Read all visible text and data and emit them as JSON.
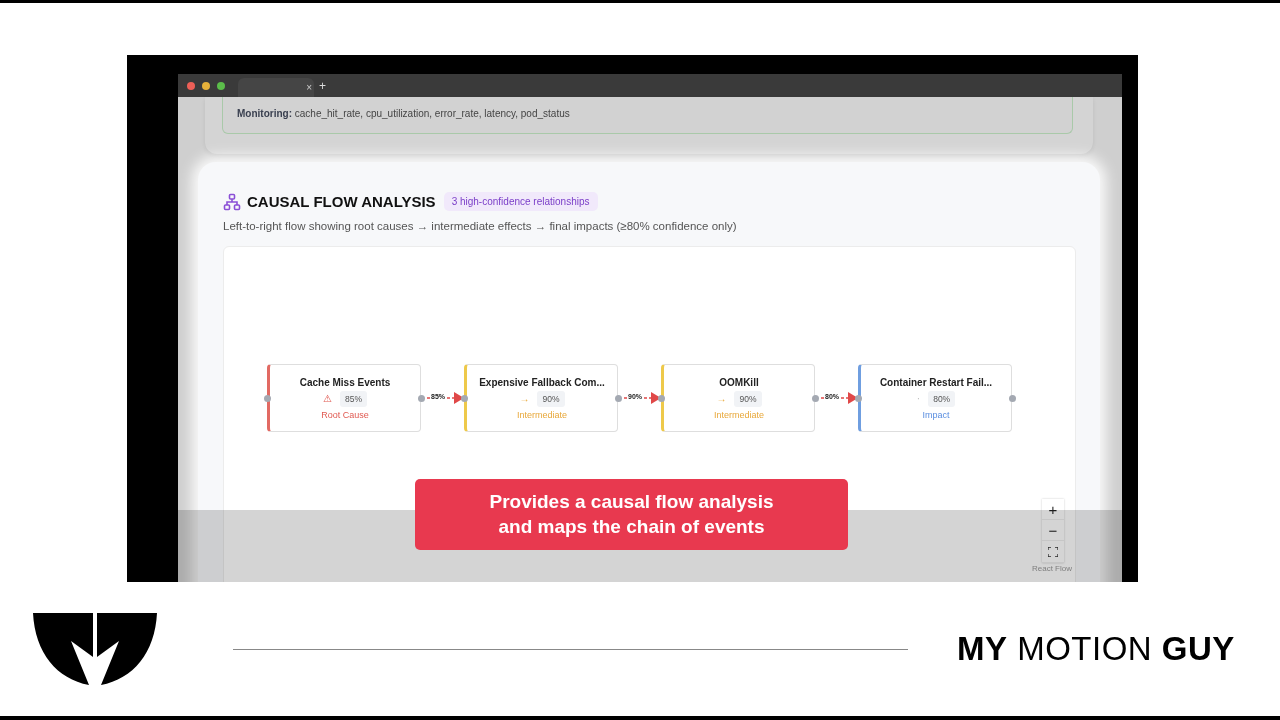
{
  "browser": {
    "tab_close": "×",
    "new_tab": "+"
  },
  "monitoring": "**Monitoring:** cache_hit_rate, cpu_utilization, error_rate, latency, pod_status",
  "section": {
    "title": "CAUSAL FLOW ANALYSIS",
    "badge": "3 high-confidence relationships",
    "subtitle": "Left-to-right flow showing root causes → intermediate effects → final impacts (≥80% confidence only)"
  },
  "nodes": [
    {
      "title": "Cache Miss Events",
      "icon": "⚠",
      "confidence": "85%",
      "role": "Root Cause",
      "kind": "root"
    },
    {
      "title": "Expensive Fallback Com...",
      "icon": "→",
      "confidence": "90%",
      "role": "Intermediate",
      "kind": "intermediate"
    },
    {
      "title": "OOMKill",
      "icon": "→",
      "confidence": "90%",
      "role": "Intermediate",
      "kind": "intermediate"
    },
    {
      "title": "Container Restart Fail...",
      "icon": "·",
      "confidence": "80%",
      "role": "Impact",
      "kind": "impact"
    }
  ],
  "edges": [
    {
      "label": "85%"
    },
    {
      "label": "90%"
    },
    {
      "label": "80%"
    }
  ],
  "controls": [
    {
      "kind": "text",
      "label": "+"
    },
    {
      "kind": "text",
      "label": "−"
    },
    {
      "kind": "fit"
    }
  ],
  "attribution": "React Flow",
  "caption": "Provides a causal flow analysis and maps the chain of events",
  "brand": "**MY** MOTION **GUY**"
}
